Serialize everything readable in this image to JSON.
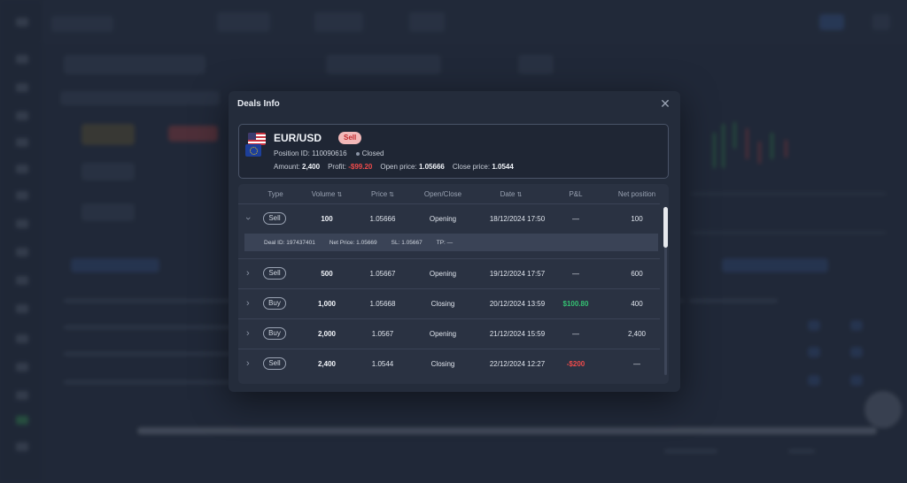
{
  "modal": {
    "title": "Deals Info"
  },
  "summary": {
    "pair": "EUR/USD",
    "side": "Sell",
    "position_id_label": "Position ID:",
    "position_id": "110090616",
    "status": "Closed",
    "amount_label": "Amount:",
    "amount": "2,400",
    "profit_label": "Profit:",
    "profit": "-$99.20",
    "open_price_label": "Open price:",
    "open_price": "1.05666",
    "close_price_label": "Close price:",
    "close_price": "1.0544"
  },
  "table": {
    "headers": {
      "type": "Type",
      "volume": "Volume",
      "price": "Price",
      "open_close": "Open/Close",
      "date": "Date",
      "pnl": "P&L",
      "net_position": "Net position"
    },
    "rows": [
      {
        "type": "Sell",
        "volume": "100",
        "price": "1.05666",
        "open_close": "Opening",
        "date": "18/12/2024 17:50",
        "pnl": "—",
        "net_position": "100"
      },
      {
        "type": "Sell",
        "volume": "500",
        "price": "1.05667",
        "open_close": "Opening",
        "date": "19/12/2024 17:57",
        "pnl": "—",
        "net_position": "600"
      },
      {
        "type": "Buy",
        "volume": "1,000",
        "price": "1.05668",
        "open_close": "Closing",
        "date": "20/12/2024 13:59",
        "pnl": "$100.80",
        "net_position": "400"
      },
      {
        "type": "Buy",
        "volume": "2,000",
        "price": "1.0567",
        "open_close": "Opening",
        "date": "21/12/2024 15:59",
        "pnl": "—",
        "net_position": "2,400"
      },
      {
        "type": "Sell",
        "volume": "2,400",
        "price": "1.0544",
        "open_close": "Closing",
        "date": "22/12/2024 12:27",
        "pnl": "-$200",
        "net_position": "—"
      }
    ],
    "detail": {
      "deal_id": "Deal ID: 197437401",
      "net_price": "Net Price: 1.05669",
      "sl": "SL: 1.05667",
      "tp": "TP: —"
    }
  },
  "colors": {
    "positive": "#34c172",
    "negative": "#ef4b4b",
    "sell_badge_bg": "#f3b8b8"
  }
}
